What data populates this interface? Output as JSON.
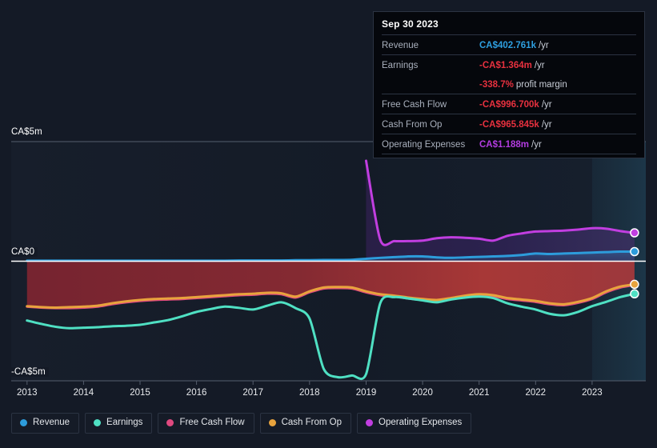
{
  "tooltip": {
    "date": "Sep 30 2023",
    "rows": [
      {
        "label": "Revenue",
        "value": "CA$402.761k",
        "unit": "/yr",
        "color": "blue"
      },
      {
        "label": "Earnings",
        "value": "-CA$1.364m",
        "unit": "/yr",
        "color": "red"
      },
      {
        "label": "",
        "value": "-338.7%",
        "unit": "profit margin",
        "color": "red"
      },
      {
        "label": "Free Cash Flow",
        "value": "-CA$996.700k",
        "unit": "/yr",
        "color": "red"
      },
      {
        "label": "Cash From Op",
        "value": "-CA$965.845k",
        "unit": "/yr",
        "color": "red"
      },
      {
        "label": "Operating Expenses",
        "value": "CA$1.188m",
        "unit": "/yr",
        "color": "purple"
      }
    ]
  },
  "legend": {
    "items": [
      {
        "label": "Revenue",
        "color": "#2d9cdb"
      },
      {
        "label": "Earnings",
        "color": "#4fe0c3"
      },
      {
        "label": "Free Cash Flow",
        "color": "#e0497f"
      },
      {
        "label": "Cash From Op",
        "color": "#e8a33d"
      },
      {
        "label": "Operating Expenses",
        "color": "#c13ee0"
      }
    ]
  },
  "chart_data": {
    "type": "area",
    "title": "",
    "xlabel": "",
    "ylabel": "",
    "ylim": [
      -5,
      5
    ],
    "ytick_labels": [
      "CA$5m",
      "CA$0",
      "-CA$5m"
    ],
    "ytick_values": [
      5,
      0,
      -5
    ],
    "currency": "CA$",
    "unit": "millions",
    "grid": true,
    "legend_position": "bottom",
    "categories": [
      "2013",
      "2014",
      "2015",
      "2016",
      "2017",
      "2018",
      "2019",
      "2020",
      "2021",
      "2022",
      "2023"
    ],
    "x": [
      2013.0,
      2013.25,
      2013.5,
      2013.75,
      2014.0,
      2014.25,
      2014.5,
      2014.75,
      2015.0,
      2015.25,
      2015.5,
      2015.75,
      2016.0,
      2016.25,
      2016.5,
      2016.75,
      2017.0,
      2017.25,
      2017.5,
      2017.75,
      2018.0,
      2018.25,
      2018.5,
      2018.75,
      2019.0,
      2019.25,
      2019.5,
      2019.75,
      2020.0,
      2020.25,
      2020.5,
      2020.75,
      2021.0,
      2021.25,
      2021.5,
      2021.75,
      2022.0,
      2022.25,
      2022.5,
      2022.75,
      2023.0,
      2023.25,
      2023.5,
      2023.75
    ],
    "series": [
      {
        "name": "Revenue",
        "color": "#2d9cdb",
        "fill": true,
        "values": [
          0.02,
          0.02,
          0.02,
          0.02,
          0.02,
          0.02,
          0.02,
          0.02,
          0.02,
          0.02,
          0.02,
          0.02,
          0.02,
          0.02,
          0.02,
          0.03,
          0.03,
          0.03,
          0.03,
          0.04,
          0.04,
          0.05,
          0.05,
          0.06,
          0.1,
          0.14,
          0.17,
          0.2,
          0.2,
          0.16,
          0.14,
          0.16,
          0.18,
          0.2,
          0.22,
          0.26,
          0.32,
          0.3,
          0.32,
          0.34,
          0.36,
          0.38,
          0.4,
          0.403
        ]
      },
      {
        "name": "Earnings",
        "color": "#4fe0c3",
        "fill": false,
        "values": [
          -2.48,
          -2.62,
          -2.74,
          -2.8,
          -2.78,
          -2.76,
          -2.72,
          -2.7,
          -2.66,
          -2.56,
          -2.46,
          -2.3,
          -2.12,
          -2.0,
          -1.9,
          -1.95,
          -2.02,
          -1.86,
          -1.72,
          -1.96,
          -2.4,
          -4.5,
          -4.85,
          -4.78,
          -4.72,
          -1.76,
          -1.5,
          -1.56,
          -1.64,
          -1.72,
          -1.6,
          -1.52,
          -1.48,
          -1.54,
          -1.76,
          -1.9,
          -2.02,
          -2.2,
          -2.26,
          -2.12,
          -1.88,
          -1.7,
          -1.5,
          -1.364
        ]
      },
      {
        "name": "Free Cash Flow",
        "color": "#e0497f",
        "fill": true,
        "values": [
          -1.9,
          -1.94,
          -1.96,
          -1.96,
          -1.94,
          -1.9,
          -1.8,
          -1.72,
          -1.66,
          -1.62,
          -1.6,
          -1.58,
          -1.54,
          -1.5,
          -1.46,
          -1.42,
          -1.4,
          -1.36,
          -1.38,
          -1.52,
          -1.3,
          -1.14,
          -1.12,
          -1.14,
          -1.3,
          -1.42,
          -1.48,
          -1.56,
          -1.62,
          -1.66,
          -1.58,
          -1.48,
          -1.42,
          -1.46,
          -1.58,
          -1.64,
          -1.7,
          -1.8,
          -1.84,
          -1.74,
          -1.58,
          -1.3,
          -1.1,
          -0.997
        ]
      },
      {
        "name": "Cash From Op",
        "color": "#e8a33d",
        "fill": false,
        "values": [
          -1.88,
          -1.92,
          -1.94,
          -1.92,
          -1.9,
          -1.86,
          -1.76,
          -1.68,
          -1.62,
          -1.58,
          -1.56,
          -1.54,
          -1.5,
          -1.46,
          -1.42,
          -1.38,
          -1.36,
          -1.32,
          -1.34,
          -1.48,
          -1.26,
          -1.1,
          -1.08,
          -1.1,
          -1.26,
          -1.38,
          -1.44,
          -1.52,
          -1.58,
          -1.62,
          -1.54,
          -1.44,
          -1.38,
          -1.42,
          -1.54,
          -1.6,
          -1.66,
          -1.76,
          -1.8,
          -1.7,
          -1.54,
          -1.26,
          -1.06,
          -0.966
        ]
      },
      {
        "name": "Operating Expenses",
        "color": "#c13ee0",
        "fill": true,
        "start_index": 24,
        "values": [
          null,
          null,
          null,
          null,
          null,
          null,
          null,
          null,
          null,
          null,
          null,
          null,
          null,
          null,
          null,
          null,
          null,
          null,
          null,
          null,
          null,
          null,
          null,
          null,
          4.2,
          0.9,
          0.84,
          0.84,
          0.86,
          0.96,
          1.0,
          0.98,
          0.94,
          0.86,
          1.06,
          1.16,
          1.24,
          1.26,
          1.28,
          1.32,
          1.38,
          1.36,
          1.26,
          1.188
        ]
      }
    ],
    "highlight_band": {
      "from": "2023.0",
      "to": "2023.75",
      "label": "forecast-period"
    },
    "endpoint_markers": [
      "Operating Expenses",
      "Revenue",
      "Cash From Op",
      "Earnings"
    ]
  }
}
